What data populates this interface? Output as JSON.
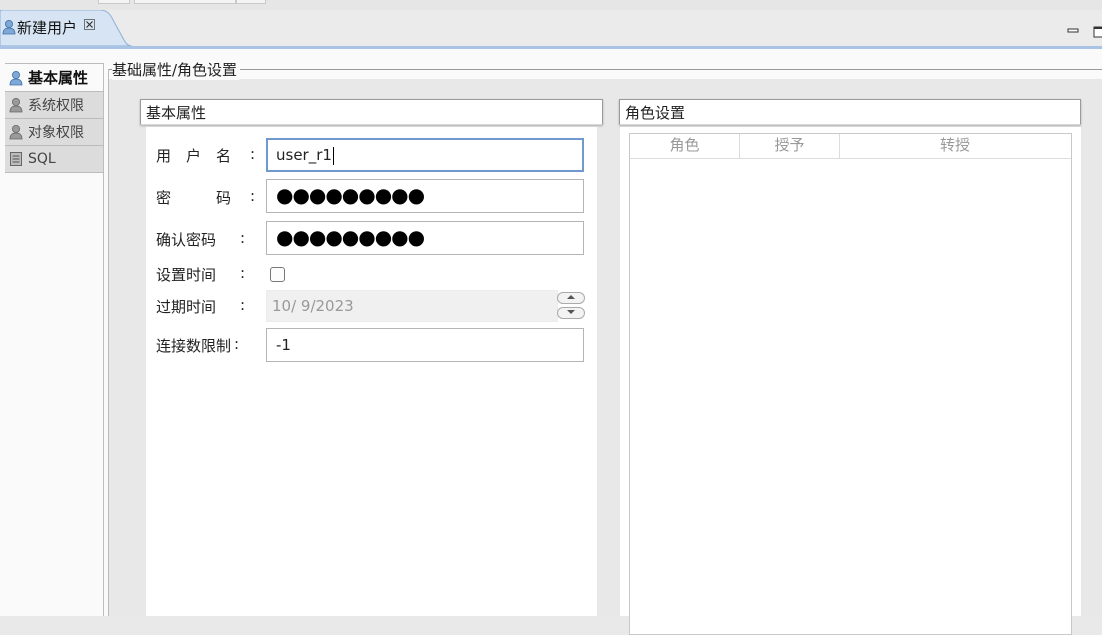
{
  "tab": {
    "title": "新建用户",
    "close_icon": "close-icon"
  },
  "nav": {
    "items": [
      {
        "label": "基本属性",
        "icon": "user-icon",
        "active": true
      },
      {
        "label": "系统权限",
        "icon": "user-icon",
        "active": false
      },
      {
        "label": "对象权限",
        "icon": "user-icon",
        "active": false
      },
      {
        "label": "SQL",
        "icon": "document-icon",
        "active": false
      }
    ]
  },
  "group": {
    "title": "基础属性/角色设置"
  },
  "basic": {
    "title": "基本属性",
    "username_label": "用　户　名",
    "username_value": "user_r1",
    "password_label": "密　　　码",
    "password_value": "●●●●●●●●●",
    "confirm_label": "确认密码",
    "confirm_value": "●●●●●●●●●",
    "settime_label": "设置时间",
    "expire_label": "过期时间",
    "expire_value": "10/ 9/2023",
    "connlimit_label": "连接数限制",
    "connlimit_value": "-1",
    "colon": ":"
  },
  "roles": {
    "title": "角色设置",
    "columns": [
      "角色",
      "授予",
      "转授"
    ]
  }
}
